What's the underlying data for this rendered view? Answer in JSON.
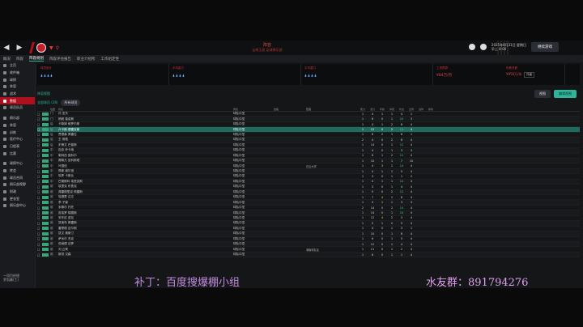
{
  "titlebar": {
    "title": "阵容",
    "subtitle": "云南玉昆 足球俱乐部",
    "date_line1": "2025年8月31日 星期日",
    "date_line2": "早上 8:00",
    "continue_label": "继续游戏"
  },
  "subnav": [
    "概况",
    "阵容",
    "阵容规划",
    "阵容评估报告",
    "职业介绍所",
    "工作组定性"
  ],
  "sidebar": {
    "items": [
      "主页",
      "收件箱",
      "球探",
      "阵容",
      "战术",
      "数据",
      "球员队员",
      "俱乐部",
      "阵容",
      "训练",
      "医疗中心",
      "日程表",
      "比赛",
      "球探中心",
      "转会",
      "球员合同",
      "俱乐部视野",
      "财政",
      "更衣室",
      "俱乐部中心"
    ],
    "active_index": 5,
    "footer_line1": "一项目经理",
    "footer_line2": "罗凯森(工)"
  },
  "stats": [
    {
      "label": "球员统计",
      "drops": "🌢🌢🌢🌢"
    },
    {
      "label": "平均能力",
      "drops": "🌢🌢🌢🌢"
    },
    {
      "label": "平均潜力",
      "drops": "🌢🌢🌢🌢"
    },
    {
      "label": "工资预算",
      "value": "¥84万/月",
      "label2": "年薪总额",
      "value2": "¥956万/年",
      "pill": "升级"
    }
  ],
  "toolbar": {
    "page_label": "阵容视图",
    "btn1": "视图",
    "btn2": "编辑视图"
  },
  "filter": {
    "count": "全部球员 (28)",
    "chip": "所有球员"
  },
  "table": {
    "headers": [
      "",
      "",
      "位置",
      "姓名",
      "角色",
      "性格",
      "信息",
      "能力",
      "潜力",
      "年龄",
      "体能",
      "状态",
      "出场",
      "进球",
      "助攻"
    ],
    "rows": [
      {
        "pos": "门",
        "name": "孙 亚东",
        "role": "球队中坚",
        "pers": "",
        "extra": "",
        "n": [
          1,
          4,
          1,
          1,
          4,
          1
        ]
      },
      {
        "pos": "门",
        "name": "杨毅 普诺斯",
        "role": "球队中坚",
        "pers": "",
        "extra": "",
        "n": [
          1,
          6,
          0,
          1,
          10,
          3
        ]
      },
      {
        "pos": "后",
        "name": "卡勒姆 维罗尔斯",
        "role": "球队中坚",
        "pers": "",
        "extra": "",
        "n": [
          1,
          4,
          1,
          2,
          8,
          4
        ]
      },
      {
        "pos": "后",
        "name": "卢卡斯 德雷克斯",
        "role": "球队中坚",
        "pers": "",
        "extra": "",
        "n": [
          1,
          12,
          0,
          2,
          14,
          4
        ],
        "sel": true
      },
      {
        "pos": "后",
        "name": "贾德森 佩雷拉",
        "role": "球队中坚",
        "pers": "",
        "extra": "",
        "n": [
          1,
          6,
          2,
          1,
          6,
          1
        ]
      },
      {
        "pos": "后",
        "name": "王 常皓",
        "role": "球队中坚",
        "pers": "",
        "extra": "",
        "n": [
          2,
          4,
          0,
          2,
          8,
          4
        ]
      },
      {
        "pos": "后",
        "name": "史蒂文 巴普斯",
        "role": "球队中坚",
        "pers": "",
        "extra": "",
        "n": [
          1,
          14,
          0,
          1,
          12,
          4
        ]
      },
      {
        "pos": "中",
        "name": "迈克 乔卡纳",
        "role": "球队中坚",
        "pers": "",
        "extra": "",
        "n": [
          1,
          4,
          0,
          1,
          3,
          3
        ]
      },
      {
        "pos": "中",
        "name": "勒特西 莫科尔",
        "role": "球队中坚",
        "pers": "",
        "extra": "",
        "n": [
          1,
          6,
          1,
          2,
          12,
          4
        ]
      },
      {
        "pos": "中",
        "name": "赛勒凡 尼科斯塔",
        "role": "球队中坚",
        "pers": "",
        "extra": "",
        "n": [
          1,
          10,
          1,
          1,
          7,
          10
        ]
      },
      {
        "pos": "中",
        "name": "叶国信",
        "role": "球队中坚",
        "pers": "",
        "extra": "白云大学",
        "n": [
          1,
          4,
          3,
          1,
          14,
          4
        ]
      },
      {
        "pos": "中",
        "name": "佩斯 威尔逊",
        "role": "球队中坚",
        "pers": "",
        "extra": "",
        "n": [
          1,
          4,
          1,
          1,
          5,
          4
        ]
      },
      {
        "pos": "中",
        "name": "埃罗 卡斯比",
        "role": "球队中坚",
        "pers": "",
        "extra": "",
        "n": [
          1,
          3,
          0,
          1,
          1,
          2
        ]
      },
      {
        "pos": "中",
        "name": "巴黎斯科 埃里克斯",
        "role": "球队中坚",
        "pers": "",
        "extra": "",
        "n": [
          1,
          4,
          1,
          1,
          14,
          4
        ]
      },
      {
        "pos": "前",
        "name": "埃里克 布鲁克",
        "role": "球队中坚",
        "pers": "",
        "extra": "",
        "n": [
          1,
          3,
          0,
          1,
          4,
          4
        ]
      },
      {
        "pos": "前",
        "name": "弗雷德里克 佩雷斯",
        "role": "球队中坚",
        "pers": "",
        "extra": "",
        "n": [
          1,
          5,
          0,
          2,
          12,
          4
        ]
      },
      {
        "pos": "前",
        "name": "埃德蒙 达文",
        "role": "球队中坚",
        "pers": "",
        "extra": "",
        "n": [
          1,
          7,
          4,
          1,
          8,
          4
        ]
      },
      {
        "pos": "前",
        "name": "李 子豪",
        "role": "球队中坚",
        "pers": "",
        "extra": "",
        "n": [
          1,
          3,
          1,
          1,
          3,
          3
        ]
      },
      {
        "pos": "前",
        "name": "米歇尔 托托",
        "role": "球队中坚",
        "pers": "",
        "extra": "",
        "n": [
          2,
          14,
          0,
          2,
          14,
          4
        ]
      },
      {
        "pos": "前",
        "name": "皮埃罗 瑞德斯",
        "role": "球队中坚",
        "pers": "",
        "extra": "",
        "n": [
          1,
          14,
          0,
          1,
          10,
          4
        ]
      },
      {
        "pos": "前",
        "name": "安东尼 诺瓦",
        "role": "球队中坚",
        "pers": "",
        "extra": "",
        "n": [
          1,
          12,
          4,
          2,
          3,
          4
        ]
      },
      {
        "pos": "前",
        "name": "凯莱布 佩雷斯",
        "role": "球队中坚",
        "pers": "",
        "extra": "",
        "n": [
          1,
          5,
          1,
          2,
          5,
          4
        ]
      },
      {
        "pos": "前",
        "name": "雷蒙德 迈尔斯",
        "role": "球队中坚",
        "pers": "",
        "extra": "",
        "n": [
          1,
          4,
          0,
          1,
          3,
          1
        ]
      },
      {
        "pos": "前",
        "name": "凯文 奥斯汀",
        "role": "球队中坚",
        "pers": "",
        "extra": "",
        "n": [
          1,
          10,
          0,
          1,
          8,
          4
        ]
      },
      {
        "pos": "前",
        "name": "萨米尔 杰克",
        "role": "球队中坚",
        "pers": "",
        "extra": "",
        "n": [
          1,
          6,
          0,
          1,
          5,
          4
        ]
      },
      {
        "pos": "前",
        "name": "伯纳德 法罗",
        "role": "球队中坚",
        "pers": "",
        "extra": "",
        "n": [
          1,
          12,
          0,
          1,
          4,
          4
        ]
      },
      {
        "pos": "前",
        "name": "刘 云荣",
        "role": "球队中坚",
        "pers": "",
        "extra": "湖南球友会",
        "n": [
          1,
          11,
          0,
          1,
          2,
          4
        ]
      },
      {
        "pos": "前",
        "name": "斯坦 汉森",
        "role": "球队中坚",
        "pers": "",
        "extra": "",
        "n": [
          1,
          6,
          0,
          1,
          1,
          4
        ]
      }
    ]
  },
  "watermark": {
    "left": "补丁：百度搜爆棚小组",
    "right": "水友群：891794276"
  }
}
